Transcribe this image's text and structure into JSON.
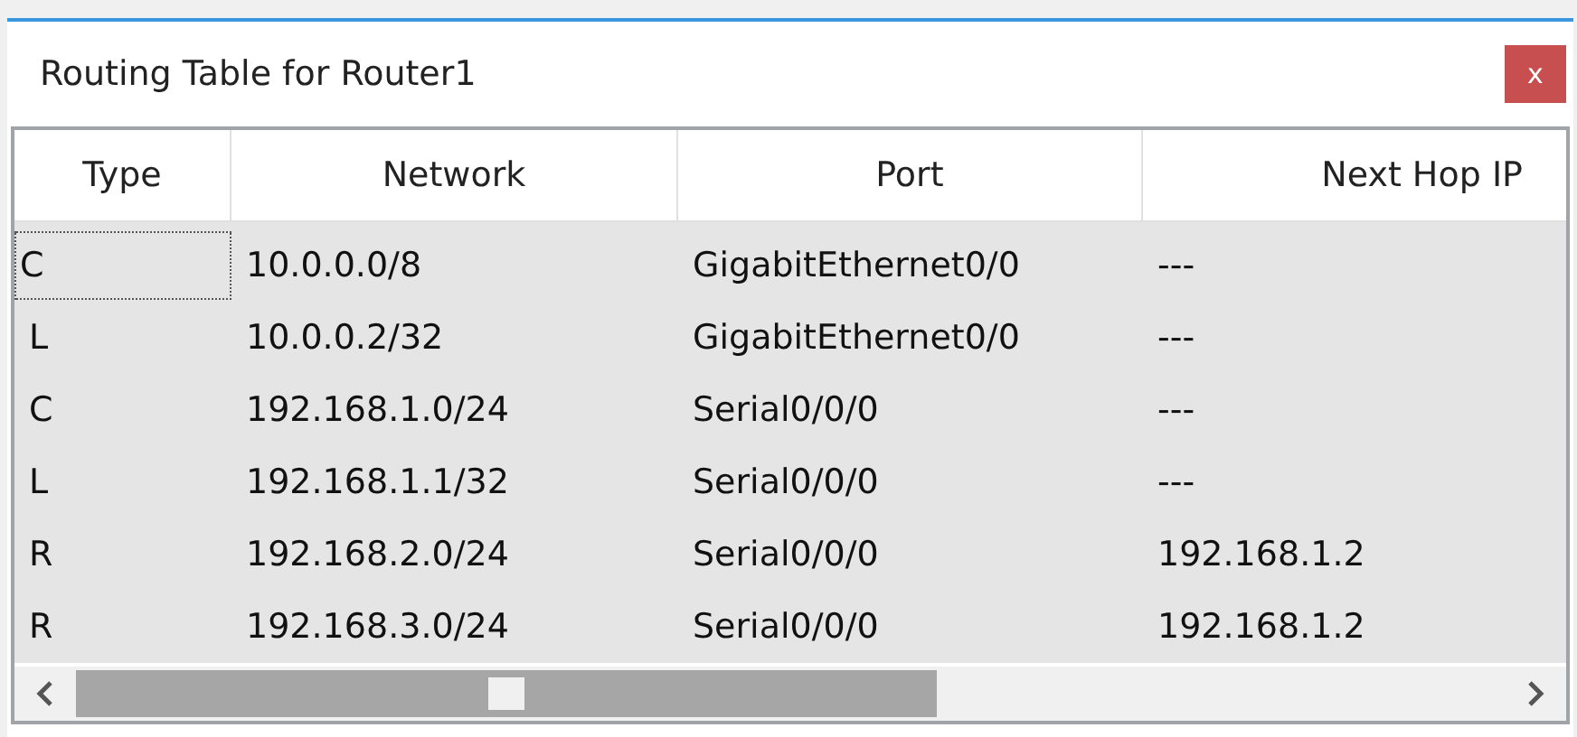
{
  "window": {
    "title": "Routing Table for Router1",
    "close": "x"
  },
  "table": {
    "columns": [
      "Type",
      "Network",
      "Port",
      "Next Hop IP"
    ],
    "rows": [
      [
        "C",
        "10.0.0.0/8",
        "GigabitEthernet0/0",
        "---"
      ],
      [
        "L",
        "10.0.0.2/32",
        "GigabitEthernet0/0",
        "---"
      ],
      [
        "C",
        "192.168.1.0/24",
        "Serial0/0/0",
        "---"
      ],
      [
        "L",
        "192.168.1.1/32",
        "Serial0/0/0",
        "---"
      ],
      [
        "R",
        "192.168.2.0/24",
        "Serial0/0/0",
        "192.168.1.2"
      ],
      [
        "R",
        "192.168.3.0/24",
        "Serial0/0/0",
        "192.168.1.2"
      ]
    ]
  }
}
